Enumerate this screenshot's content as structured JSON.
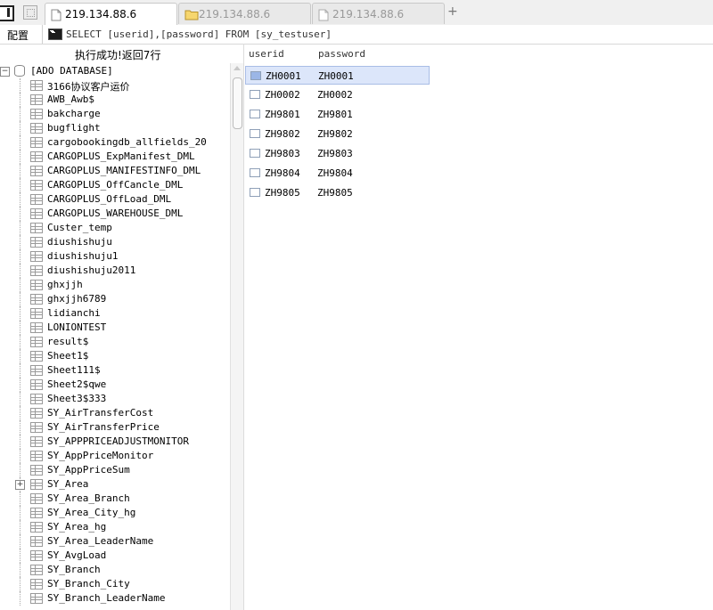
{
  "tabs": [
    {
      "label": "219.134.88.6",
      "icon": "document-icon",
      "active": true
    },
    {
      "label": "219.134.88.6",
      "icon": "folder-icon",
      "active": false
    },
    {
      "label": "219.134.88.6",
      "icon": "document-icon",
      "active": false
    }
  ],
  "new_tab": "+",
  "toolbar": {
    "config_label": "配置",
    "query": "SELECT [userid],[password] FROM [sy_testuser]"
  },
  "status": "执行成功!返回7行",
  "tree": {
    "root": {
      "expander": "−",
      "label": "[ADO DATABASE]"
    },
    "tables": [
      {
        "name": "3166协议客户运价",
        "expander": ""
      },
      {
        "name": "AWB_Awb$",
        "expander": ""
      },
      {
        "name": "bakcharge",
        "expander": ""
      },
      {
        "name": "bugflight",
        "expander": ""
      },
      {
        "name": "cargobookingdb_allfields_20",
        "expander": ""
      },
      {
        "name": "CARGOPLUS_ExpManifest_DML",
        "expander": ""
      },
      {
        "name": "CARGOPLUS_MANIFESTINFO_DML",
        "expander": ""
      },
      {
        "name": "CARGOPLUS_OffCancle_DML",
        "expander": ""
      },
      {
        "name": "CARGOPLUS_OffLoad_DML",
        "expander": ""
      },
      {
        "name": "CARGOPLUS_WAREHOUSE_DML",
        "expander": ""
      },
      {
        "name": "Custer_temp",
        "expander": ""
      },
      {
        "name": "diushishuju",
        "expander": ""
      },
      {
        "name": "diushishuju1",
        "expander": ""
      },
      {
        "name": "diushishuju2011",
        "expander": ""
      },
      {
        "name": "ghxjjh",
        "expander": ""
      },
      {
        "name": "ghxjjh6789",
        "expander": ""
      },
      {
        "name": "lidianchi",
        "expander": ""
      },
      {
        "name": "LONIONTEST",
        "expander": ""
      },
      {
        "name": "result$",
        "expander": ""
      },
      {
        "name": "Sheet1$",
        "expander": ""
      },
      {
        "name": "Sheet111$",
        "expander": ""
      },
      {
        "name": "Sheet2$qwe",
        "expander": ""
      },
      {
        "name": "Sheet3$333",
        "expander": ""
      },
      {
        "name": "SY_AirTransferCost",
        "expander": ""
      },
      {
        "name": "SY_AirTransferPrice",
        "expander": ""
      },
      {
        "name": "SY_APPPRICEADJUSTMONITOR",
        "expander": ""
      },
      {
        "name": "SY_AppPriceMonitor",
        "expander": ""
      },
      {
        "name": "SY_AppPriceSum",
        "expander": ""
      },
      {
        "name": "SY_Area",
        "expander": "+"
      },
      {
        "name": "SY_Area_Branch",
        "expander": ""
      },
      {
        "name": "SY_Area_City_hg",
        "expander": ""
      },
      {
        "name": "SY_Area_hg",
        "expander": ""
      },
      {
        "name": "SY_Area_LeaderName",
        "expander": ""
      },
      {
        "name": "SY_AvgLoad",
        "expander": ""
      },
      {
        "name": "SY_Branch",
        "expander": ""
      },
      {
        "name": "SY_Branch_City",
        "expander": ""
      },
      {
        "name": "SY_Branch_LeaderName",
        "expander": ""
      }
    ]
  },
  "grid": {
    "columns": [
      "userid",
      "password"
    ],
    "rows": [
      [
        "ZH0001",
        "ZH0001"
      ],
      [
        "ZH0002",
        "ZH0002"
      ],
      [
        "ZH9801",
        "ZH9801"
      ],
      [
        "ZH9802",
        "ZH9802"
      ],
      [
        "ZH9803",
        "ZH9803"
      ],
      [
        "ZH9804",
        "ZH9804"
      ],
      [
        "ZH9805",
        "ZH9805"
      ]
    ],
    "selected_row": 0
  },
  "colors": {
    "selection": "#dce6fa",
    "selection_border": "#a9bde6"
  }
}
